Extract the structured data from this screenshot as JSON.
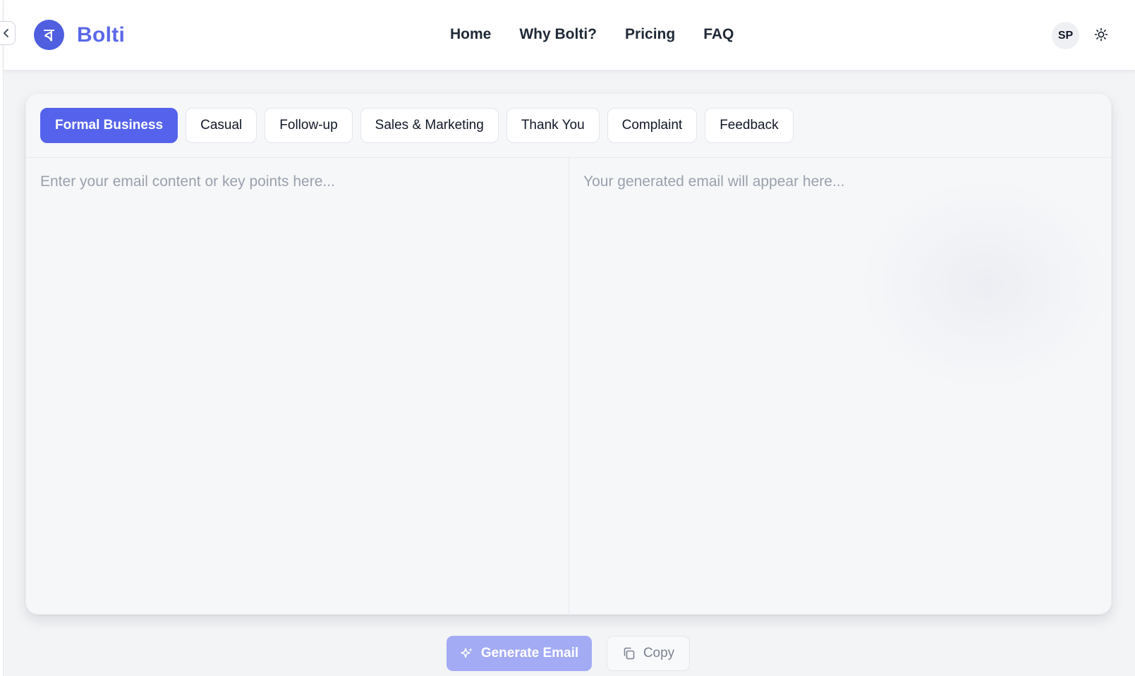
{
  "app": {
    "brand_name": "Bolti",
    "logo_glyph": "ব",
    "accent_color": "#5563ec"
  },
  "nav": {
    "items": [
      {
        "label": "Home"
      },
      {
        "label": "Why Bolti?"
      },
      {
        "label": "Pricing"
      },
      {
        "label": "FAQ"
      }
    ]
  },
  "user": {
    "initials": "SP"
  },
  "icons": {
    "collapse": "chevron-left-icon",
    "theme": "sun-icon",
    "generate": "sparkles-icon",
    "copy": "copy-icon"
  },
  "tabs": [
    {
      "label": "Formal Business",
      "active": true
    },
    {
      "label": "Casual",
      "active": false
    },
    {
      "label": "Follow-up",
      "active": false
    },
    {
      "label": "Sales & Marketing",
      "active": false
    },
    {
      "label": "Thank You",
      "active": false
    },
    {
      "label": "Complaint",
      "active": false
    },
    {
      "label": "Feedback",
      "active": false
    }
  ],
  "editor": {
    "input_value": "",
    "input_placeholder": "Enter your email content or key points here...",
    "output_placeholder": "Your generated email will appear here..."
  },
  "actions": {
    "generate_label": "Generate Email",
    "copy_label": "Copy"
  }
}
